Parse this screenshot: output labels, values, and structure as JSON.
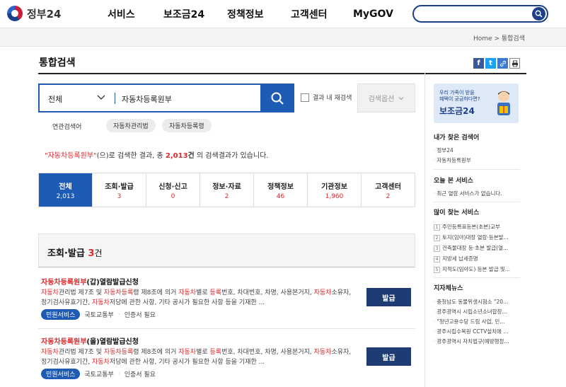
{
  "header": {
    "logo_text": "정부24",
    "nav": [
      "서비스",
      "보조금24",
      "정책정보",
      "고객센터",
      "MyGOV"
    ]
  },
  "breadcrumb": {
    "home": "Home",
    "sep": ">",
    "current": "통합검색"
  },
  "page_title": "통합검색",
  "search": {
    "category": "전체",
    "query": "자동차등록원부",
    "within_label": "결과 내 재검색",
    "options_label": "검색옵션"
  },
  "related": {
    "label": "연관검색어",
    "tags": [
      "자동차관리법",
      "자동차등록령"
    ]
  },
  "result_summary": {
    "query_quoted": "\"자동차등록원부\"",
    "text1": "(으)로 검색한 결과, 총 ",
    "total": "2,013",
    "text2": "건",
    "text3": " 의 검색결과가 있습니다."
  },
  "tabs": [
    {
      "label": "전체",
      "count": "2,013"
    },
    {
      "label": "조회·발급",
      "count": "3"
    },
    {
      "label": "신청·신고",
      "count": "0"
    },
    {
      "label": "정보·자료",
      "count": "2"
    },
    {
      "label": "정책정보",
      "count": "46"
    },
    {
      "label": "기관정보",
      "count": "1,960"
    },
    {
      "label": "고객센터",
      "count": "2"
    }
  ],
  "section": {
    "title": "조회·발급",
    "count": "3",
    "unit": "건"
  },
  "results": [
    {
      "title_hl": "자동차등록원부",
      "title_rest": "(갑)열람발급신청",
      "desc_line1": [
        {
          "t": "자동차",
          "h": true
        },
        {
          "t": "관리법 제7조 및 ",
          "h": false
        },
        {
          "t": "자동차등록",
          "h": true
        },
        {
          "t": "령 제8조에 의거 ",
          "h": false
        },
        {
          "t": "자동차",
          "h": true
        },
        {
          "t": "별로 ",
          "h": false
        },
        {
          "t": "등록",
          "h": true
        },
        {
          "t": "번호, 차대번호, 차명, 사용본거지, ",
          "h": false
        },
        {
          "t": "자동차",
          "h": true
        },
        {
          "t": "소유자,",
          "h": false
        }
      ],
      "desc_line2": [
        {
          "t": "정기검사유효기간, ",
          "h": false
        },
        {
          "t": "자동차",
          "h": true
        },
        {
          "t": "저당에 관한 사항, 기타 공시가 필요한 사항 등을 기재한 ...",
          "h": false
        }
      ],
      "badge": "민원서비스",
      "org": "국토교통부",
      "cert": "인증서 필요",
      "button": "발급"
    },
    {
      "title_hl": "자동차등록원부",
      "title_rest": "(을)열람발급신청",
      "desc_line1": [
        {
          "t": "자동차",
          "h": true
        },
        {
          "t": "관리법 제7조 및 ",
          "h": false
        },
        {
          "t": "자동차등록",
          "h": true
        },
        {
          "t": "령 제8조에 의거 ",
          "h": false
        },
        {
          "t": "자동차",
          "h": true
        },
        {
          "t": "별로 ",
          "h": false
        },
        {
          "t": "등록",
          "h": true
        },
        {
          "t": "번호, 차대번호, 차명, 사용본거지, ",
          "h": false
        },
        {
          "t": "자동차",
          "h": true
        },
        {
          "t": "소유자,",
          "h": false
        }
      ],
      "desc_line2": [
        {
          "t": "정기검사유효기간, ",
          "h": false
        },
        {
          "t": "자동차",
          "h": true
        },
        {
          "t": "저당에 관한 사항, 기타 공시가 필요한 사항 등을 기재한 ...",
          "h": false
        }
      ],
      "badge": "민원서비스",
      "org": "국토교통부",
      "cert": "인증서 필요",
      "button": "발급"
    }
  ],
  "sidebar": {
    "banner_line1": "우리 가족이 받을",
    "banner_line2": "혜택이 궁금하다면?",
    "banner_title": "보조금24",
    "my_search_title": "내가 찾은 검색어",
    "my_search": [
      "정부24",
      "자동차등록원부"
    ],
    "today_title": "오늘 본 서비스",
    "today_empty": "최근 열람 서비스가 없습니다.",
    "popular_title": "많이 찾는 서비스",
    "popular": [
      "주민등록표등본(초본)교부",
      "토지(임야)대장 열람·등본발...",
      "건축물대장 등·초본 발급(열...",
      "지방세 납세증명",
      "지적도(임야도) 등본 발급 및..."
    ],
    "news_title": "지자체뉴스",
    "news": [
      "충청남도 동물위생시험소 \"20...",
      "광주광역시 시립소년소녀합창...",
      "\"청년고용수당 드림 사업, 민...",
      "광주시립수목원 CCTV설치에 ...",
      "광주광역시 자치법규(예방행정..."
    ]
  },
  "colors": {
    "primary": "#1d5bb5",
    "highlight": "#e0272a",
    "dark_button": "#1f3b73"
  }
}
